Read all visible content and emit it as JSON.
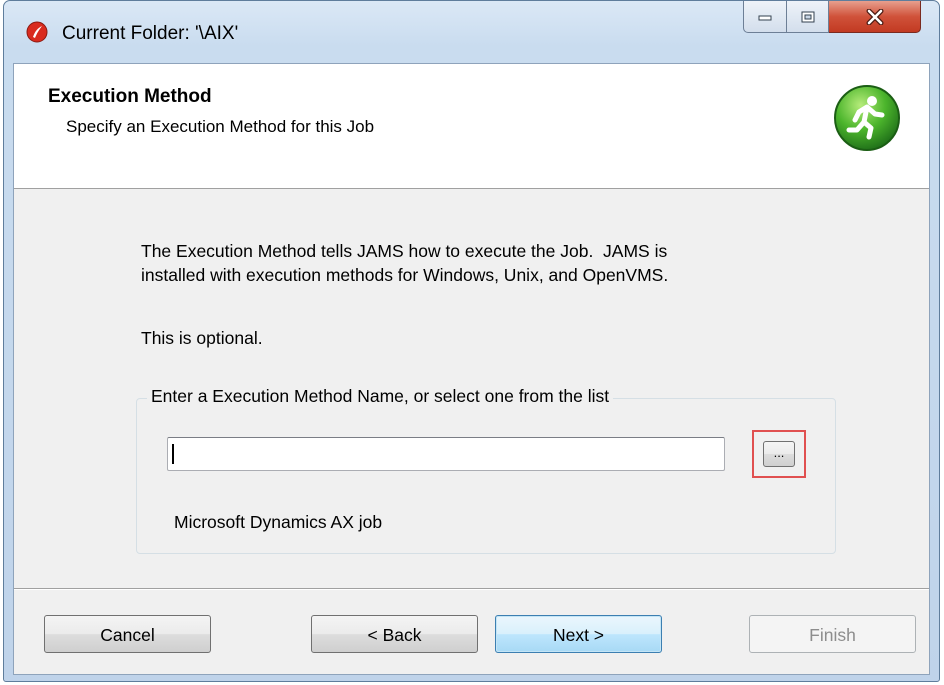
{
  "window": {
    "title": "Current Folder: '\\AIX'",
    "controls": {
      "minimize": "minimize",
      "maximize": "maximize",
      "close": "close"
    }
  },
  "header": {
    "title": "Execution Method",
    "subtitle": "Specify an Execution Method for this Job",
    "icon": "runner-icon"
  },
  "body": {
    "description": "The Execution Method tells JAMS how to execute the Job.  JAMS is\ninstalled with execution methods for Windows, Unix, and OpenVMS.",
    "optional_note": "This is optional."
  },
  "method_group": {
    "legend": "Enter a Execution Method Name, or select one from the list",
    "input_value": "",
    "browse_label": "...",
    "selected_description": "Microsoft Dynamics AX job"
  },
  "buttons": {
    "cancel": "Cancel",
    "back": "< Back",
    "next": "Next >",
    "finish": "Finish"
  },
  "colors": {
    "highlight_box": "#e05050",
    "accent_green": "#3fae2a"
  }
}
